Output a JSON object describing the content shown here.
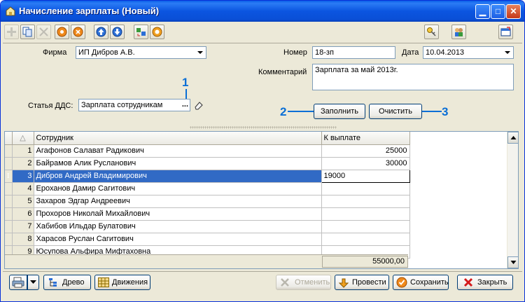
{
  "window": {
    "title": "Начисление зарплаты (Новый)"
  },
  "toolbar": {
    "buttons": [
      {
        "icon": "add-icon",
        "enabled": false
      },
      {
        "icon": "copy-icon",
        "enabled": true
      },
      {
        "icon": "delete-icon",
        "enabled": false
      },
      {
        "icon": "orange-circle-icon",
        "enabled": true
      },
      {
        "icon": "orange-cross-icon",
        "enabled": true
      },
      {
        "icon": "arrow-up-icon",
        "enabled": true
      },
      {
        "icon": "arrow-down-icon",
        "enabled": true
      },
      {
        "icon": "sort-icon",
        "enabled": true
      },
      {
        "icon": "settings-icon",
        "enabled": true
      }
    ]
  },
  "form": {
    "firm_label": "Фирма",
    "firm_value": "ИП Дибров А.В.",
    "number_label": "Номер",
    "number_value": "18-зп",
    "date_label": "Дата",
    "date_value": "10.04.2013",
    "comment_label": "Комментарий",
    "comment_value": "Зарплата за май 2013г.",
    "dds_label": "Статья ДДС:",
    "dds_value": "Зарплата сотрудникам",
    "dds_ellipsis": "...",
    "fill_button": "Заполнить",
    "clear_button": "Очистить"
  },
  "annotations": {
    "a1": "1",
    "a2": "2",
    "a3": "3"
  },
  "table": {
    "columns": [
      "Сотрудник",
      "К выплате"
    ],
    "sort_glyph": "△",
    "rows": [
      {
        "n": "1",
        "name": "Агафонов Салават Радикович",
        "amount": "25000"
      },
      {
        "n": "2",
        "name": "Байрамов Алик Русланович",
        "amount": "30000"
      },
      {
        "n": "3",
        "name": "Дибров Андрей Владимирович",
        "amount": "19000",
        "selected": true,
        "marker": "I"
      },
      {
        "n": "4",
        "name": "Ероханов Дамир Сагитович",
        "amount": ""
      },
      {
        "n": "5",
        "name": "Захаров Эдгар Андреевич",
        "amount": ""
      },
      {
        "n": "6",
        "name": "Прохоров Николай Михайлович",
        "amount": ""
      },
      {
        "n": "7",
        "name": "Хабибов Ильдар Булатович",
        "amount": ""
      },
      {
        "n": "8",
        "name": "Харасов  Руслан  Сагитович",
        "amount": ""
      },
      {
        "n": "9",
        "name": "Юсупова Альфира Мифтаховна",
        "amount": ""
      }
    ],
    "total": "55000,00"
  },
  "bottom": {
    "tree_button": "Древо",
    "movements_button": "Движения",
    "cancel_button": "Отменить",
    "post_button": "Провести",
    "save_button": "Сохранить",
    "close_button": "Закрыть"
  },
  "colors": {
    "accent": "#316ac5",
    "annotation": "#0a6fd6",
    "titlebar": "#0a5fe8"
  }
}
